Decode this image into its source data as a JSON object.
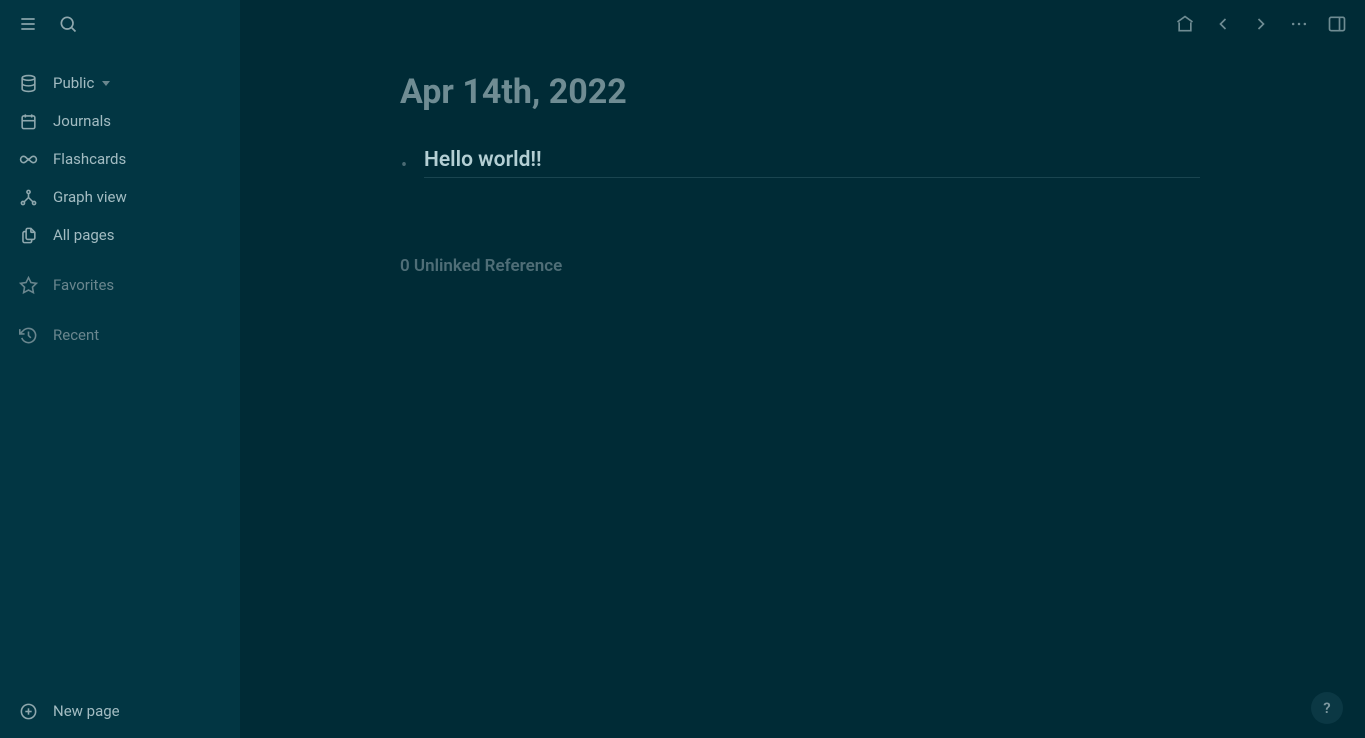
{
  "sidebar": {
    "graph_name": "Public",
    "items": [
      {
        "label": "Journals"
      },
      {
        "label": "Flashcards"
      },
      {
        "label": "Graph view"
      },
      {
        "label": "All pages"
      }
    ],
    "secondary": [
      {
        "label": "Favorites"
      },
      {
        "label": "Recent"
      }
    ],
    "new_page_label": "New page"
  },
  "page": {
    "title": "Apr 14th, 2022",
    "block_text": "Hello world!!",
    "unlinked_ref": "0 Unlinked Reference"
  },
  "help_label": "?"
}
